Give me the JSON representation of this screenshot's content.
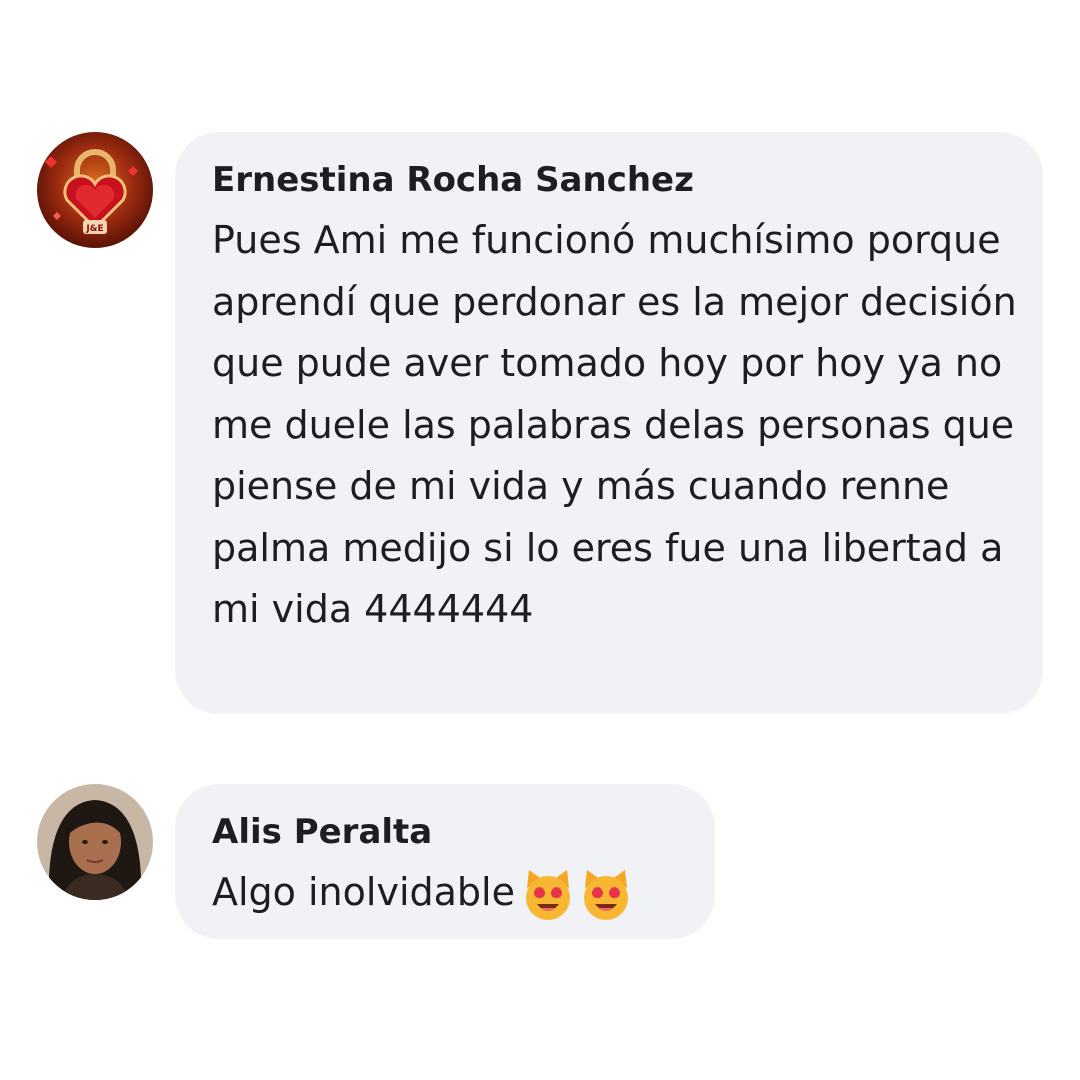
{
  "comments": [
    {
      "author": "Ernestina Rocha Sanchez",
      "text": "Pues Ami me funcionó muchísimo porque aprendí que perdonar es la mejor decisión que pude aver tomado hoy por hoy ya no me duele las palabras delas personas que piense de mi vida y más cuando renne palma medijo si lo eres fue una libertad a mi vida 4444444",
      "avatar_icon": "heart-lock-avatar",
      "avatar_text": "J&E"
    },
    {
      "author": "Alis Peralta",
      "text": "Algo inolvidable",
      "avatar_icon": "woman-portrait-avatar",
      "emojis": [
        "smiling-cat-heart-eyes-emoji",
        "smiling-cat-heart-eyes-emoji"
      ]
    }
  ],
  "colors": {
    "bubble_bg": "#f0f2f5",
    "text": "#1c1e21",
    "page_bg": "#ffffff"
  }
}
